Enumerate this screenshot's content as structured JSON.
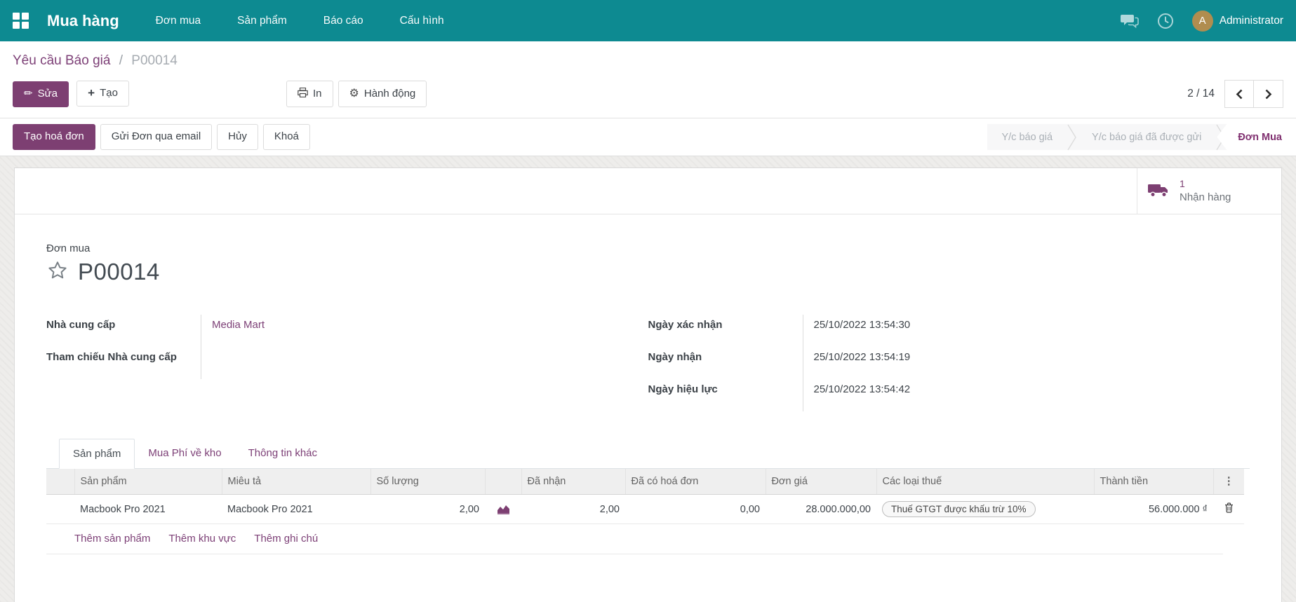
{
  "colors": {
    "navbar_teal": "#0d8a91",
    "primary_purple": "#7d3f72",
    "link_purple": "#7d4077",
    "avatar_gold": "#b08d4f"
  },
  "navbar": {
    "app_name": "Mua hàng",
    "menu": [
      "Đơn mua",
      "Sản phẩm",
      "Báo cáo",
      "Cấu hình"
    ],
    "user_name": "Administrator",
    "avatar_initial": "A"
  },
  "breadcrumb": {
    "parent": "Yêu cầu Báo giá",
    "separator": "/",
    "current": "P00014"
  },
  "control_panel": {
    "edit_label": "Sửa",
    "create_label": "Tạo",
    "print_label": "In",
    "action_label": "Hành động",
    "pager_value": "2 / 14"
  },
  "statusbar": {
    "buttons": [
      {
        "label": "Tạo hoá đơn"
      },
      {
        "label": "Gửi Đơn qua email"
      },
      {
        "label": "Hủy"
      },
      {
        "label": "Khoá"
      }
    ],
    "steps": [
      {
        "label": "Y/c báo giá"
      },
      {
        "label": "Y/c báo giá đã được gửi"
      },
      {
        "label": "Đơn Mua"
      }
    ]
  },
  "smart_button": {
    "count": "1",
    "label": "Nhận hàng"
  },
  "form": {
    "type_label": "Đơn mua",
    "title": "P00014",
    "fields_left": [
      {
        "label": "Nhà cung cấp",
        "value": "Media Mart"
      },
      {
        "label": "Tham chiếu Nhà cung cấp",
        "value": ""
      }
    ],
    "fields_right": [
      {
        "label": "Ngày xác nhận",
        "value": "25/10/2022 13:54:30"
      },
      {
        "label": "Ngày nhận",
        "value": "25/10/2022 13:54:19"
      },
      {
        "label": "Ngày hiệu lực",
        "value": "25/10/2022 13:54:42"
      }
    ]
  },
  "tabs": [
    {
      "label": "Sản phẩm"
    },
    {
      "label": "Mua Phí về kho"
    },
    {
      "label": "Thông tin khác"
    }
  ],
  "table": {
    "headers": [
      "Sản phẩm",
      "Miêu tả",
      "Số lượng",
      "",
      "Đã nhận",
      "Đã có hoá đơn",
      "Đơn giá",
      "Các loại thuế",
      "Thành tiền"
    ],
    "options_glyph": "⋮",
    "rows": [
      {
        "product": "Macbook Pro 2021",
        "description": "Macbook Pro 2021",
        "qty": "2,00",
        "received": "2,00",
        "billed": "0,00",
        "unit_price": "28.000.000,00",
        "tax": "Thuế GTGT được khấu trừ 10%",
        "subtotal": "56.000.000 ₫"
      }
    ],
    "links": [
      "Thêm sản phẩm",
      "Thêm khu vực",
      "Thêm ghi chú"
    ]
  }
}
